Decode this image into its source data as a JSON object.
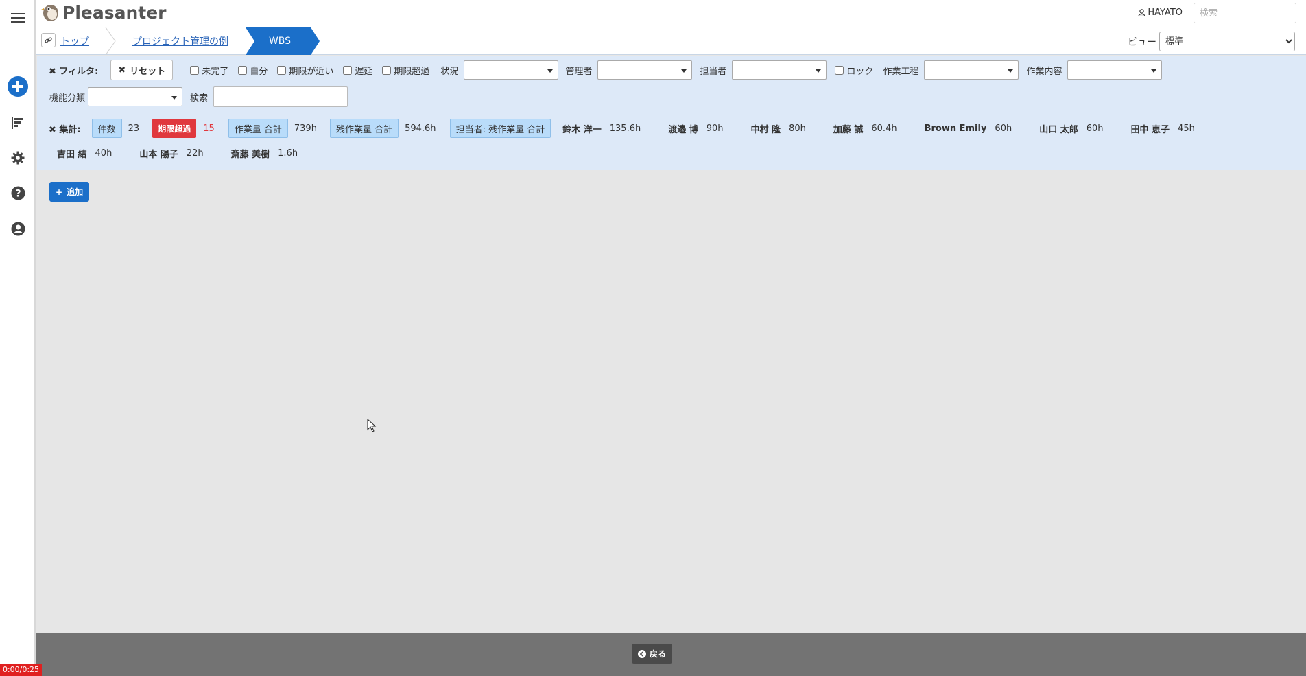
{
  "app": {
    "logo_text": "Pleasanter"
  },
  "header": {
    "user": "HAYATO",
    "search_placeholder": "検索"
  },
  "breadcrumb": {
    "items": [
      "トップ",
      "プロジェクト管理の例",
      "WBS"
    ]
  },
  "view": {
    "label": "ビュー",
    "selected": "標準"
  },
  "filters": {
    "title": "フィルタ:",
    "reset_label": "リセット",
    "checkboxes": [
      "未完了",
      "自分",
      "期限が近い",
      "遅延",
      "期限超過"
    ],
    "status_label": "状況",
    "manager_label": "管理者",
    "owner_label": "担当者",
    "lock_label": "ロック",
    "process_label": "作業工程",
    "content_label": "作業内容",
    "function_label": "機能分類",
    "search_label": "検索"
  },
  "aggregations": {
    "title": "集計:",
    "count_label": "件数",
    "count_value": "23",
    "overdue_label": "期限超過",
    "overdue_value": "15",
    "workload_label": "作業量 合計",
    "workload_value": "739h",
    "remaining_label": "残作業量 合計",
    "remaining_value": "594.6h",
    "owner_remaining_label": "担当者: 残作業量 合計",
    "people": [
      {
        "name": "鈴木 洋一",
        "value": "135.6h"
      },
      {
        "name": "渡邉 博",
        "value": "90h"
      },
      {
        "name": "中村 隆",
        "value": "80h"
      },
      {
        "name": "加藤 誠",
        "value": "60.4h"
      },
      {
        "name": "Brown Emily",
        "value": "60h"
      },
      {
        "name": "山口 太郎",
        "value": "60h"
      },
      {
        "name": "田中 恵子",
        "value": "45h"
      },
      {
        "name": "吉田 結",
        "value": "40h"
      },
      {
        "name": "山本 陽子",
        "value": "22h"
      },
      {
        "name": "斎藤 美樹",
        "value": "1.6h"
      }
    ]
  },
  "actions": {
    "add_label": "追加",
    "back_label": "戻る"
  },
  "timer": "0:00/0:25",
  "colors": {
    "accent": "#1b6fc9",
    "danger": "#e0383e",
    "panel": "#dde9f8",
    "footer": "#737373"
  }
}
